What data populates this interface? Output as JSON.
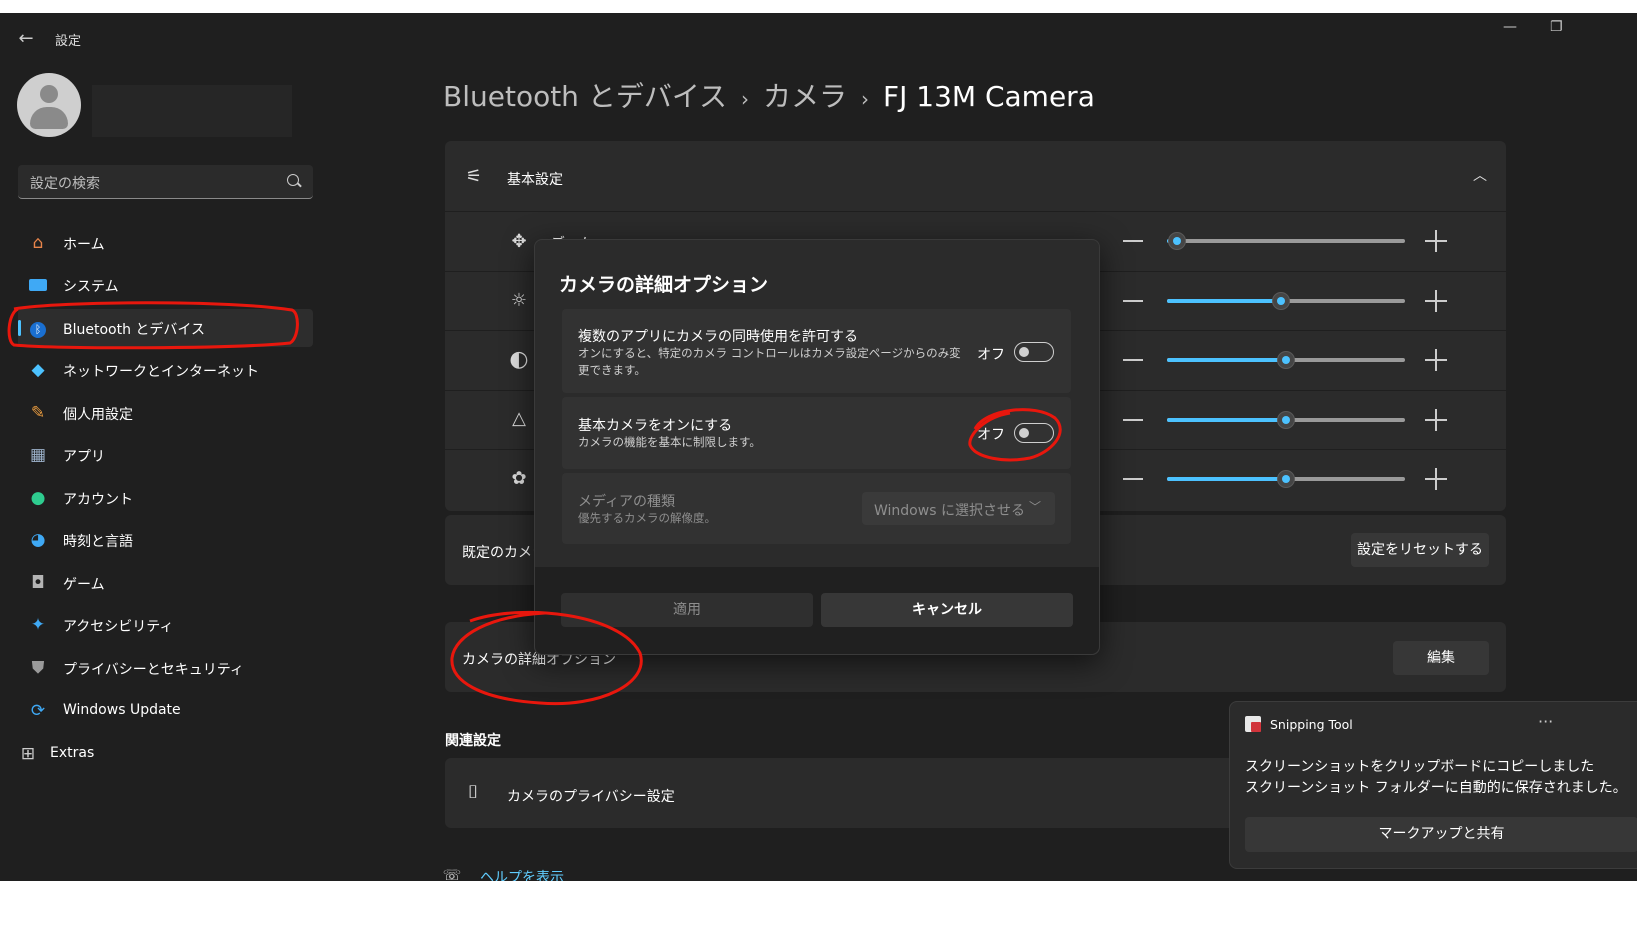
{
  "window": {
    "title": "設定",
    "back_icon": "back-arrow-icon"
  },
  "sidebar": {
    "search_placeholder": "設定の検索",
    "items": [
      {
        "label": "ホーム",
        "icon": "home-icon",
        "color": "#e8854a"
      },
      {
        "label": "システム",
        "icon": "monitor-icon",
        "color": "#3fa9f5"
      },
      {
        "label": "Bluetooth とデバイス",
        "icon": "bluetooth-icon",
        "color": "#1a6fd1"
      },
      {
        "label": "ネットワークとインターネット",
        "icon": "wifi-icon",
        "color": "#4cc2ff"
      },
      {
        "label": "個人用設定",
        "icon": "brush-icon",
        "color": "#e89b3f"
      },
      {
        "label": "アプリ",
        "icon": "apps-icon",
        "color": "#9bb0c9"
      },
      {
        "label": "アカウント",
        "icon": "person-icon",
        "color": "#2ecc8f"
      },
      {
        "label": "時刻と言語",
        "icon": "globe-clock-icon",
        "color": "#3fa9f5"
      },
      {
        "label": "ゲーム",
        "icon": "gamepad-icon",
        "color": "#b4b4b4"
      },
      {
        "label": "アクセシビリティ",
        "icon": "accessibility-icon",
        "color": "#3fa9f5"
      },
      {
        "label": "プライバシーとセキュリティ",
        "icon": "shield-icon",
        "color": "#9a9a9a"
      },
      {
        "label": "Windows Update",
        "icon": "update-icon",
        "color": "#3fa9f5"
      },
      {
        "label": "Extras",
        "icon": "extras-icon",
        "color": "#cccccc"
      }
    ]
  },
  "breadcrumb": {
    "items": [
      "Bluetooth とデバイス",
      "カメラ",
      "FJ 13M Camera"
    ],
    "separator": "›"
  },
  "basic_settings": {
    "title": "基本設定",
    "partial_label": "ズーム",
    "sliders": [
      {
        "icon": "zoom-icon",
        "value_percent": 4
      },
      {
        "icon": "brightness-icon",
        "value_percent": 48
      },
      {
        "icon": "contrast-icon",
        "value_percent": 50
      },
      {
        "icon": "sharpness-icon",
        "value_percent": 50
      },
      {
        "icon": "saturation-icon",
        "value_percent": 50
      }
    ]
  },
  "default_camera": {
    "label": "既定のカメラ",
    "reset_button": "設定をリセットする"
  },
  "advanced": {
    "label": "カメラの詳細オプション",
    "edit_button": "編集"
  },
  "related": {
    "heading": "関連設定",
    "privacy_label": "カメラのプライバシー設定",
    "help_link": "ヘルプを表示"
  },
  "dialog": {
    "title": "カメラの詳細オプション",
    "option1_title": "複数のアプリにカメラの同時使用を許可する",
    "option1_desc": "オンにすると、特定のカメラ コントロールはカメラ設定ページからのみ変更できます。",
    "option1_state": "オフ",
    "option2_title": "基本カメラをオンにする",
    "option2_desc": "カメラの機能を基本に制限します。",
    "option2_state": "オフ",
    "option3_title": "メディアの種類",
    "option3_desc": "優先するカメラの解像度。",
    "option3_value": "Windows に選択させる",
    "apply_button": "適用",
    "cancel_button": "キャンセル"
  },
  "toast": {
    "app_name": "Snipping Tool",
    "more": "···",
    "line1": "スクリーンショットをクリップボードにコピーしました",
    "line2": "スクリーンショット フォルダーに自動的に保存されました。",
    "button": "マークアップと共有"
  },
  "colors": {
    "accent": "#4cc2ff",
    "annotation": "#e8170d",
    "window_bg": "#1f1f1f",
    "card_bg": "#2b2b2b"
  }
}
